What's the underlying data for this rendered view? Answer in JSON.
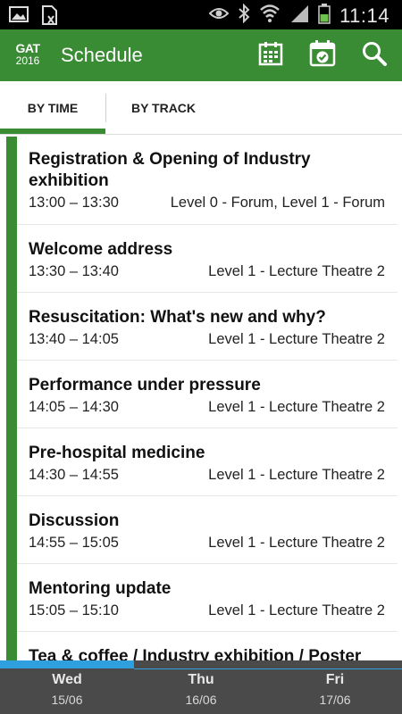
{
  "status_bar": {
    "time": "11:14",
    "left_icons": [
      "image-icon",
      "sim-file-icon"
    ],
    "right_icons": [
      "eye-icon",
      "bluetooth-icon",
      "wifi-icon",
      "signal-icon",
      "battery-icon"
    ]
  },
  "app_bar": {
    "logo_line1": "GAT",
    "logo_line2": "2016",
    "title": "Schedule",
    "actions": [
      "calendar-grid-icon",
      "calendar-check-icon",
      "search-icon"
    ],
    "color": "#3a8c34"
  },
  "tabs": [
    {
      "label": "BY TIME",
      "selected": true
    },
    {
      "label": "BY TRACK",
      "selected": false
    }
  ],
  "sessions": [
    {
      "title": "Registration & Opening of Industry exhibition",
      "time": "13:00 – 13:30",
      "room": "Level 0 - Forum, Level 1 - Forum"
    },
    {
      "title": "Welcome address",
      "time": "13:30 – 13:40",
      "room": "Level 1 - Lecture Theatre 2"
    },
    {
      "title": "Resuscitation: What's new and why?",
      "time": "13:40 – 14:05",
      "room": "Level 1 - Lecture Theatre 2"
    },
    {
      "title": "Performance under pressure",
      "time": "14:05 – 14:30",
      "room": "Level 1 - Lecture Theatre 2"
    },
    {
      "title": "Pre-hospital medicine",
      "time": "14:30 – 14:55",
      "room": "Level 1 - Lecture Theatre 2"
    },
    {
      "title": "Discussion",
      "time": "14:55 – 15:05",
      "room": "Level 1 - Lecture Theatre 2"
    },
    {
      "title": "Mentoring update",
      "time": "15:05 – 15:10",
      "room": "Level 1 - Lecture Theatre 2"
    },
    {
      "title": "Tea & coffee / Industry exhibition / Poster",
      "time": "",
      "room": ""
    }
  ],
  "days": [
    {
      "name": "Wed",
      "date": "15/06",
      "selected": true
    },
    {
      "name": "Thu",
      "date": "16/06",
      "selected": false
    },
    {
      "name": "Fri",
      "date": "17/06",
      "selected": false
    }
  ],
  "colors": {
    "accent": "#3a8c34",
    "day_bar": "#4a4a4a",
    "day_indicator": "#2f9fe0"
  }
}
